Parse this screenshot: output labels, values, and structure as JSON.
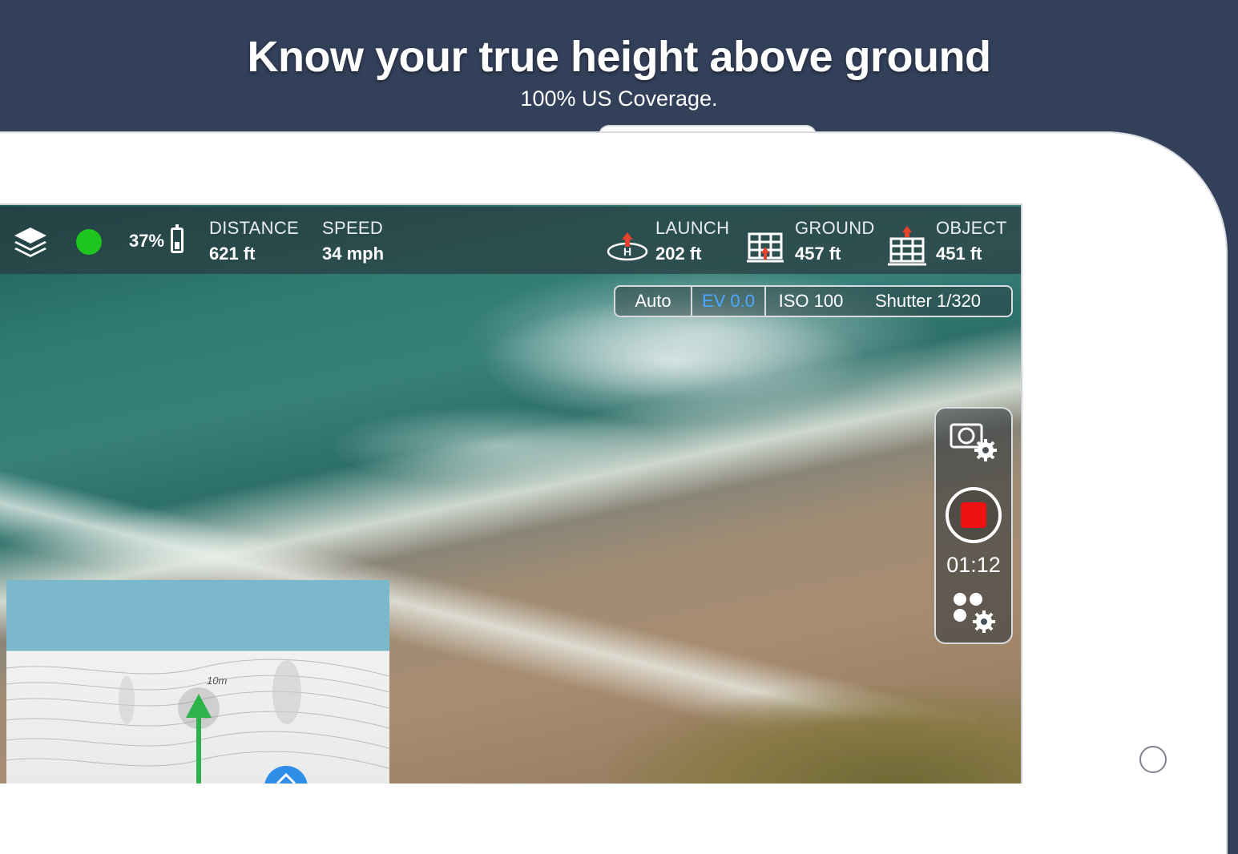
{
  "banner": {
    "title": "Know your true height above ground",
    "subtitle": "100% US Coverage."
  },
  "telemetry": {
    "battery": "37%",
    "distance": {
      "label": "DISTANCE",
      "value": "621 ft"
    },
    "speed": {
      "label": "SPEED",
      "value": "34 mph"
    },
    "launch": {
      "label": "LAUNCH",
      "value": "202 ft"
    },
    "ground": {
      "label": "GROUND",
      "value": "457 ft"
    },
    "object": {
      "label": "OBJECT",
      "value": "451 ft"
    },
    "gps_status_color": "#1ec51e"
  },
  "camera": {
    "mode": "Auto",
    "ev": "EV 0.0",
    "iso": "ISO 100",
    "shutter": "Shutter 1/320"
  },
  "recording": {
    "time": "01:12",
    "record_color": "#ee1111"
  },
  "minimap": {
    "scale_label": "10m"
  },
  "icons": {
    "layers": "layers-icon",
    "launch": "launch-helipad-icon",
    "ground": "ground-building-icon",
    "object": "object-building-icon",
    "camera_settings": "camera-settings-icon",
    "drone_settings": "drone-settings-icon"
  }
}
